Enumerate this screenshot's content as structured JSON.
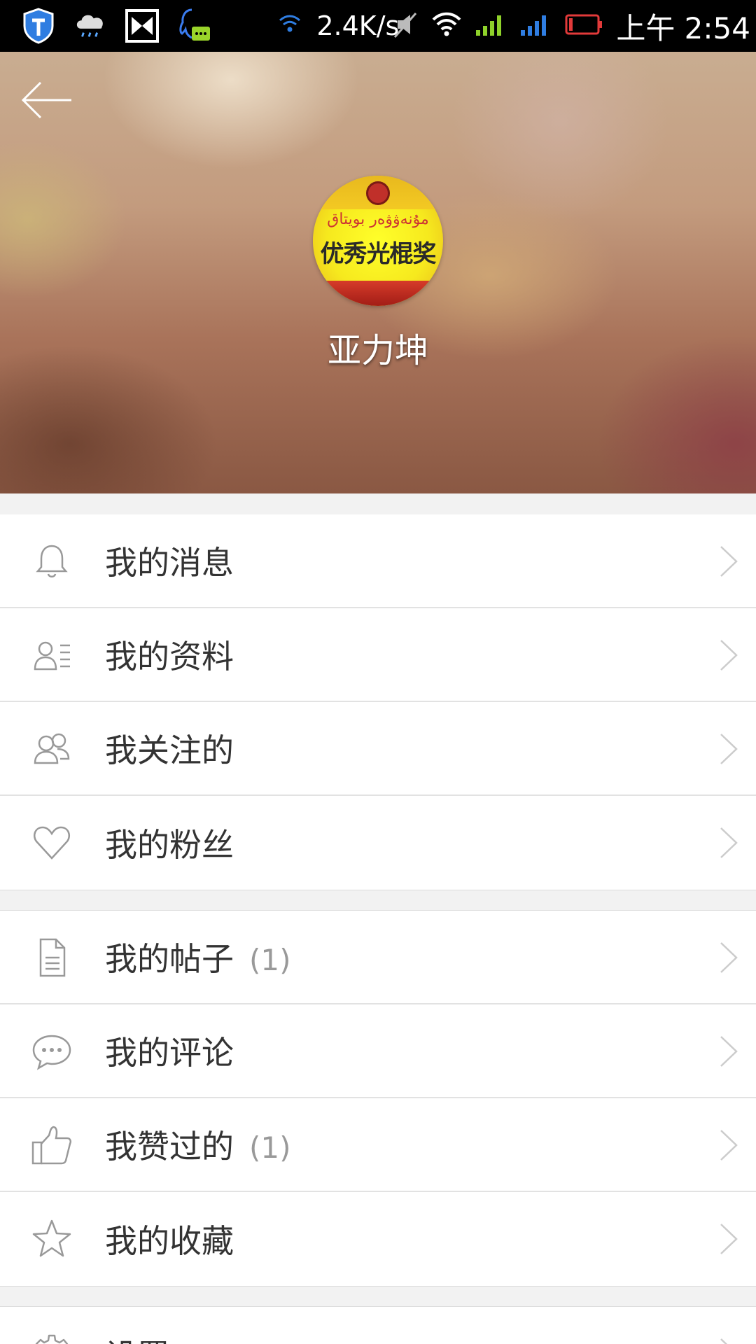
{
  "status_bar": {
    "speed": "2.4K/s",
    "time": "上午 2:54",
    "icons": [
      "shield-icon",
      "cloud-rain-icon",
      "butterfly-icon",
      "qq-message-icon",
      "wifi-hotspot-icon",
      "mute-icon",
      "wifi-icon",
      "signal-1-icon",
      "signal-2-icon",
      "battery-icon"
    ]
  },
  "header": {
    "back_icon": "arrow-left-icon",
    "avatar_text_cn": "优秀光棍奖",
    "avatar_text_uy": "مۇنەۋۋەر بويتاق",
    "username": "亚力坤"
  },
  "menu": {
    "group1": [
      {
        "label": "我的消息",
        "icon": "bell-icon",
        "count": ""
      },
      {
        "label": "我的资料",
        "icon": "profile-card-icon",
        "count": ""
      },
      {
        "label": "我关注的",
        "icon": "following-users-icon",
        "count": ""
      },
      {
        "label": "我的粉丝",
        "icon": "heart-icon",
        "count": ""
      }
    ],
    "group2": [
      {
        "label": "我的帖子",
        "icon": "document-icon",
        "count": "(1)"
      },
      {
        "label": "我的评论",
        "icon": "comment-icon",
        "count": ""
      },
      {
        "label": "我赞过的",
        "icon": "thumbs-up-icon",
        "count": "(1)"
      },
      {
        "label": "我的收藏",
        "icon": "star-icon",
        "count": ""
      }
    ],
    "group3": [
      {
        "label": "设置",
        "icon": "gear-icon",
        "count": ""
      }
    ]
  },
  "colors": {
    "status_bar_bg": "#000000",
    "page_bg": "#f2f2f2",
    "label": "#333333",
    "icon_gray": "#999999",
    "count_gray": "#999999"
  }
}
